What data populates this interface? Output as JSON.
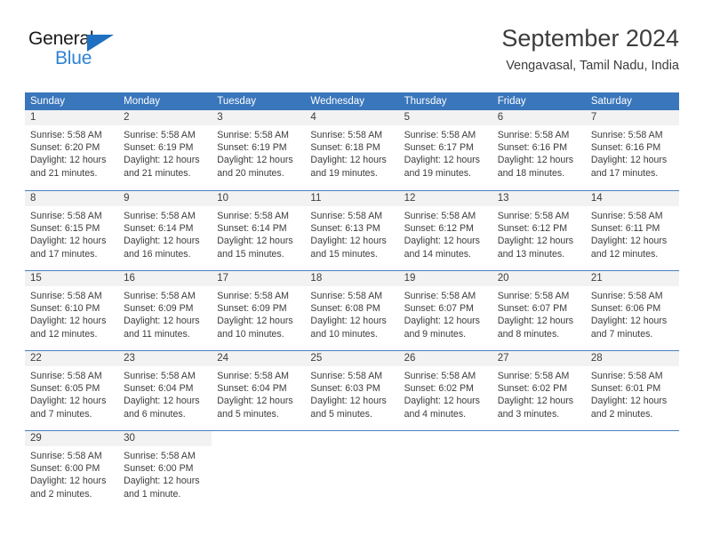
{
  "logo": {
    "word_top": "General",
    "word_bottom": "Blue",
    "triangle_color": "#1f70c1",
    "top_color": "#1a1a1a",
    "bottom_color": "#2f83d3"
  },
  "header": {
    "title": "September 2024",
    "subtitle": "Vengavasal, Tamil Nadu, India"
  },
  "theme": {
    "header_bg": "#3a76bc",
    "header_text": "#ffffff",
    "daynum_band": "#f2f2f2",
    "text": "#3c3c3c",
    "row_divider": "#4a7fc1"
  },
  "weekdays": [
    "Sunday",
    "Monday",
    "Tuesday",
    "Wednesday",
    "Thursday",
    "Friday",
    "Saturday"
  ],
  "weeks": [
    {
      "days": [
        {
          "date": "1",
          "sunrise": "Sunrise: 5:58 AM",
          "sunset": "Sunset: 6:20 PM",
          "daylight1": "Daylight: 12 hours",
          "daylight2": "and 21 minutes."
        },
        {
          "date": "2",
          "sunrise": "Sunrise: 5:58 AM",
          "sunset": "Sunset: 6:19 PM",
          "daylight1": "Daylight: 12 hours",
          "daylight2": "and 21 minutes."
        },
        {
          "date": "3",
          "sunrise": "Sunrise: 5:58 AM",
          "sunset": "Sunset: 6:19 PM",
          "daylight1": "Daylight: 12 hours",
          "daylight2": "and 20 minutes."
        },
        {
          "date": "4",
          "sunrise": "Sunrise: 5:58 AM",
          "sunset": "Sunset: 6:18 PM",
          "daylight1": "Daylight: 12 hours",
          "daylight2": "and 19 minutes."
        },
        {
          "date": "5",
          "sunrise": "Sunrise: 5:58 AM",
          "sunset": "Sunset: 6:17 PM",
          "daylight1": "Daylight: 12 hours",
          "daylight2": "and 19 minutes."
        },
        {
          "date": "6",
          "sunrise": "Sunrise: 5:58 AM",
          "sunset": "Sunset: 6:16 PM",
          "daylight1": "Daylight: 12 hours",
          "daylight2": "and 18 minutes."
        },
        {
          "date": "7",
          "sunrise": "Sunrise: 5:58 AM",
          "sunset": "Sunset: 6:16 PM",
          "daylight1": "Daylight: 12 hours",
          "daylight2": "and 17 minutes."
        }
      ]
    },
    {
      "days": [
        {
          "date": "8",
          "sunrise": "Sunrise: 5:58 AM",
          "sunset": "Sunset: 6:15 PM",
          "daylight1": "Daylight: 12 hours",
          "daylight2": "and 17 minutes."
        },
        {
          "date": "9",
          "sunrise": "Sunrise: 5:58 AM",
          "sunset": "Sunset: 6:14 PM",
          "daylight1": "Daylight: 12 hours",
          "daylight2": "and 16 minutes."
        },
        {
          "date": "10",
          "sunrise": "Sunrise: 5:58 AM",
          "sunset": "Sunset: 6:14 PM",
          "daylight1": "Daylight: 12 hours",
          "daylight2": "and 15 minutes."
        },
        {
          "date": "11",
          "sunrise": "Sunrise: 5:58 AM",
          "sunset": "Sunset: 6:13 PM",
          "daylight1": "Daylight: 12 hours",
          "daylight2": "and 15 minutes."
        },
        {
          "date": "12",
          "sunrise": "Sunrise: 5:58 AM",
          "sunset": "Sunset: 6:12 PM",
          "daylight1": "Daylight: 12 hours",
          "daylight2": "and 14 minutes."
        },
        {
          "date": "13",
          "sunrise": "Sunrise: 5:58 AM",
          "sunset": "Sunset: 6:12 PM",
          "daylight1": "Daylight: 12 hours",
          "daylight2": "and 13 minutes."
        },
        {
          "date": "14",
          "sunrise": "Sunrise: 5:58 AM",
          "sunset": "Sunset: 6:11 PM",
          "daylight1": "Daylight: 12 hours",
          "daylight2": "and 12 minutes."
        }
      ]
    },
    {
      "days": [
        {
          "date": "15",
          "sunrise": "Sunrise: 5:58 AM",
          "sunset": "Sunset: 6:10 PM",
          "daylight1": "Daylight: 12 hours",
          "daylight2": "and 12 minutes."
        },
        {
          "date": "16",
          "sunrise": "Sunrise: 5:58 AM",
          "sunset": "Sunset: 6:09 PM",
          "daylight1": "Daylight: 12 hours",
          "daylight2": "and 11 minutes."
        },
        {
          "date": "17",
          "sunrise": "Sunrise: 5:58 AM",
          "sunset": "Sunset: 6:09 PM",
          "daylight1": "Daylight: 12 hours",
          "daylight2": "and 10 minutes."
        },
        {
          "date": "18",
          "sunrise": "Sunrise: 5:58 AM",
          "sunset": "Sunset: 6:08 PM",
          "daylight1": "Daylight: 12 hours",
          "daylight2": "and 10 minutes."
        },
        {
          "date": "19",
          "sunrise": "Sunrise: 5:58 AM",
          "sunset": "Sunset: 6:07 PM",
          "daylight1": "Daylight: 12 hours",
          "daylight2": "and 9 minutes."
        },
        {
          "date": "20",
          "sunrise": "Sunrise: 5:58 AM",
          "sunset": "Sunset: 6:07 PM",
          "daylight1": "Daylight: 12 hours",
          "daylight2": "and 8 minutes."
        },
        {
          "date": "21",
          "sunrise": "Sunrise: 5:58 AM",
          "sunset": "Sunset: 6:06 PM",
          "daylight1": "Daylight: 12 hours",
          "daylight2": "and 7 minutes."
        }
      ]
    },
    {
      "days": [
        {
          "date": "22",
          "sunrise": "Sunrise: 5:58 AM",
          "sunset": "Sunset: 6:05 PM",
          "daylight1": "Daylight: 12 hours",
          "daylight2": "and 7 minutes."
        },
        {
          "date": "23",
          "sunrise": "Sunrise: 5:58 AM",
          "sunset": "Sunset: 6:04 PM",
          "daylight1": "Daylight: 12 hours",
          "daylight2": "and 6 minutes."
        },
        {
          "date": "24",
          "sunrise": "Sunrise: 5:58 AM",
          "sunset": "Sunset: 6:04 PM",
          "daylight1": "Daylight: 12 hours",
          "daylight2": "and 5 minutes."
        },
        {
          "date": "25",
          "sunrise": "Sunrise: 5:58 AM",
          "sunset": "Sunset: 6:03 PM",
          "daylight1": "Daylight: 12 hours",
          "daylight2": "and 5 minutes."
        },
        {
          "date": "26",
          "sunrise": "Sunrise: 5:58 AM",
          "sunset": "Sunset: 6:02 PM",
          "daylight1": "Daylight: 12 hours",
          "daylight2": "and 4 minutes."
        },
        {
          "date": "27",
          "sunrise": "Sunrise: 5:58 AM",
          "sunset": "Sunset: 6:02 PM",
          "daylight1": "Daylight: 12 hours",
          "daylight2": "and 3 minutes."
        },
        {
          "date": "28",
          "sunrise": "Sunrise: 5:58 AM",
          "sunset": "Sunset: 6:01 PM",
          "daylight1": "Daylight: 12 hours",
          "daylight2": "and 2 minutes."
        }
      ]
    },
    {
      "days": [
        {
          "date": "29",
          "sunrise": "Sunrise: 5:58 AM",
          "sunset": "Sunset: 6:00 PM",
          "daylight1": "Daylight: 12 hours",
          "daylight2": "and 2 minutes."
        },
        {
          "date": "30",
          "sunrise": "Sunrise: 5:58 AM",
          "sunset": "Sunset: 6:00 PM",
          "daylight1": "Daylight: 12 hours",
          "daylight2": "and 1 minute."
        },
        {
          "date": "",
          "sunrise": "",
          "sunset": "",
          "daylight1": "",
          "daylight2": ""
        },
        {
          "date": "",
          "sunrise": "",
          "sunset": "",
          "daylight1": "",
          "daylight2": ""
        },
        {
          "date": "",
          "sunrise": "",
          "sunset": "",
          "daylight1": "",
          "daylight2": ""
        },
        {
          "date": "",
          "sunrise": "",
          "sunset": "",
          "daylight1": "",
          "daylight2": ""
        },
        {
          "date": "",
          "sunrise": "",
          "sunset": "",
          "daylight1": "",
          "daylight2": ""
        }
      ]
    }
  ]
}
